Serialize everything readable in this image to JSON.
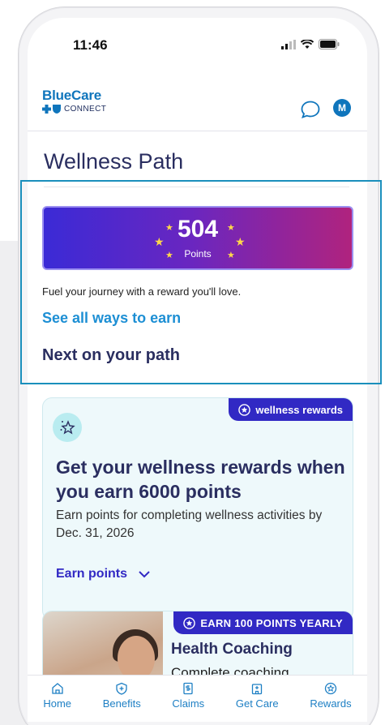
{
  "status": {
    "time": "11:46"
  },
  "header": {
    "brand": "BlueCare",
    "brand_sub": "CONNECT",
    "avatar_initial": "M"
  },
  "page": {
    "title": "Wellness Path"
  },
  "points": {
    "value": "504",
    "label": "Points"
  },
  "copy": {
    "fuel": "Fuel your journey with a reward you'll love.",
    "see_all": "See all ways to earn",
    "next": "Next on your path"
  },
  "card": {
    "badge": "wellness rewards",
    "title": "Get your wellness rewards when you earn 6000 points",
    "desc": "Earn points for completing wellness activities by Dec. 31, 2026",
    "link": "Earn points"
  },
  "card2": {
    "badge": "EARN 100 POINTS YEARLY",
    "title": "Health Coaching",
    "desc": "Complete coaching"
  },
  "tabs": [
    {
      "label": "Home",
      "icon": "home-icon"
    },
    {
      "label": "Benefits",
      "icon": "shield-plus-icon"
    },
    {
      "label": "Claims",
      "icon": "document-dollar-icon"
    },
    {
      "label": "Get Care",
      "icon": "building-icon"
    },
    {
      "label": "Rewards",
      "icon": "star-badge-icon"
    }
  ],
  "colors": {
    "brand": "#0f75bc",
    "accent": "#3129c4",
    "navy": "#2a2e60",
    "link": "#1d8fd4"
  }
}
